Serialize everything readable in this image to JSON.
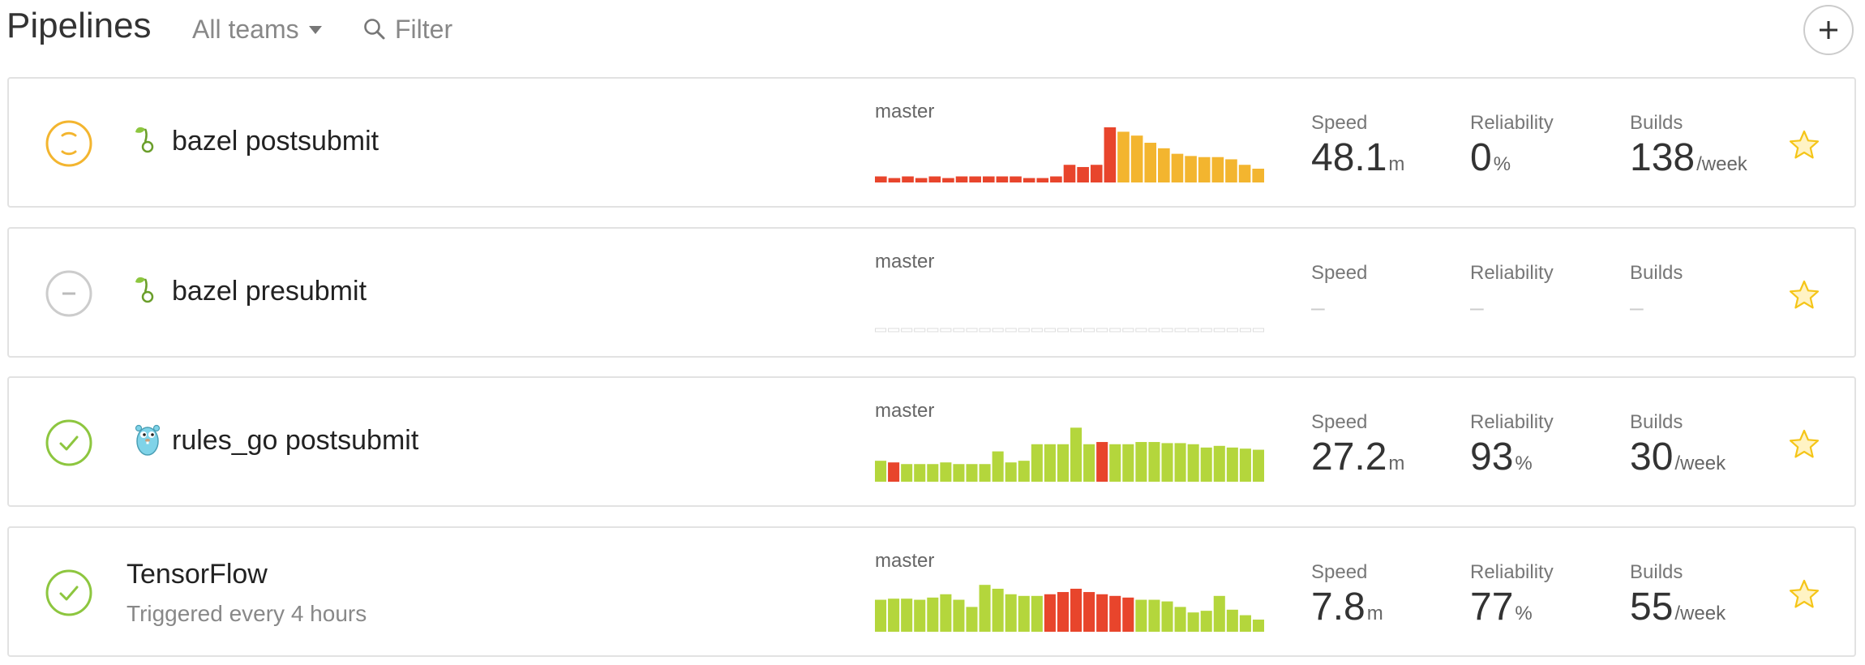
{
  "header": {
    "title": "Pipelines",
    "teams_label": "All teams",
    "filter_placeholder": "Filter"
  },
  "pipelines": [
    {
      "name": "bazel postsubmit",
      "subtitle": "",
      "status": "running",
      "icon": "bazel-sprout-icon",
      "branch": "master",
      "speed": {
        "label": "Speed",
        "value": "48.1",
        "unit": "m"
      },
      "reliability": {
        "label": "Reliability",
        "value": "0",
        "unit": "%"
      },
      "builds": {
        "label": "Builds",
        "value": "138",
        "unit": "/week"
      },
      "history": [
        {
          "v": 0.11,
          "s": "failed"
        },
        {
          "v": 0.08,
          "s": "failed"
        },
        {
          "v": 0.11,
          "s": "failed"
        },
        {
          "v": 0.08,
          "s": "failed"
        },
        {
          "v": 0.11,
          "s": "failed"
        },
        {
          "v": 0.08,
          "s": "failed"
        },
        {
          "v": 0.11,
          "s": "failed"
        },
        {
          "v": 0.11,
          "s": "failed"
        },
        {
          "v": 0.11,
          "s": "failed"
        },
        {
          "v": 0.11,
          "s": "failed"
        },
        {
          "v": 0.11,
          "s": "failed"
        },
        {
          "v": 0.08,
          "s": "failed"
        },
        {
          "v": 0.08,
          "s": "failed"
        },
        {
          "v": 0.11,
          "s": "failed"
        },
        {
          "v": 0.32,
          "s": "failed"
        },
        {
          "v": 0.28,
          "s": "failed"
        },
        {
          "v": 0.32,
          "s": "failed"
        },
        {
          "v": 1.0,
          "s": "failed"
        },
        {
          "v": 0.92,
          "s": "running"
        },
        {
          "v": 0.85,
          "s": "running"
        },
        {
          "v": 0.72,
          "s": "running"
        },
        {
          "v": 0.62,
          "s": "running"
        },
        {
          "v": 0.52,
          "s": "running"
        },
        {
          "v": 0.48,
          "s": "running"
        },
        {
          "v": 0.46,
          "s": "running"
        },
        {
          "v": 0.46,
          "s": "running"
        },
        {
          "v": 0.42,
          "s": "running"
        },
        {
          "v": 0.32,
          "s": "running"
        },
        {
          "v": 0.25,
          "s": "running"
        }
      ],
      "starred": true
    },
    {
      "name": "bazel presubmit",
      "subtitle": "",
      "status": "none",
      "icon": "bazel-sprout-icon",
      "branch": "master",
      "speed": {
        "label": "Speed",
        "value": "–",
        "unit": ""
      },
      "reliability": {
        "label": "Reliability",
        "value": "–",
        "unit": ""
      },
      "builds": {
        "label": "Builds",
        "value": "–",
        "unit": ""
      },
      "history": [
        {
          "v": 0,
          "s": "empty"
        },
        {
          "v": 0,
          "s": "empty"
        },
        {
          "v": 0,
          "s": "empty"
        },
        {
          "v": 0,
          "s": "empty"
        },
        {
          "v": 0,
          "s": "empty"
        },
        {
          "v": 0,
          "s": "empty"
        },
        {
          "v": 0,
          "s": "empty"
        },
        {
          "v": 0,
          "s": "empty"
        },
        {
          "v": 0,
          "s": "empty"
        },
        {
          "v": 0,
          "s": "empty"
        },
        {
          "v": 0,
          "s": "empty"
        },
        {
          "v": 0,
          "s": "empty"
        },
        {
          "v": 0,
          "s": "empty"
        },
        {
          "v": 0,
          "s": "empty"
        },
        {
          "v": 0,
          "s": "empty"
        },
        {
          "v": 0,
          "s": "empty"
        },
        {
          "v": 0,
          "s": "empty"
        },
        {
          "v": 0,
          "s": "empty"
        },
        {
          "v": 0,
          "s": "empty"
        },
        {
          "v": 0,
          "s": "empty"
        },
        {
          "v": 0,
          "s": "empty"
        },
        {
          "v": 0,
          "s": "empty"
        },
        {
          "v": 0,
          "s": "empty"
        },
        {
          "v": 0,
          "s": "empty"
        },
        {
          "v": 0,
          "s": "empty"
        },
        {
          "v": 0,
          "s": "empty"
        },
        {
          "v": 0,
          "s": "empty"
        },
        {
          "v": 0,
          "s": "empty"
        },
        {
          "v": 0,
          "s": "empty"
        },
        {
          "v": 0,
          "s": "empty"
        }
      ],
      "starred": true
    },
    {
      "name": "rules_go postsubmit",
      "subtitle": "",
      "status": "passed",
      "icon": "gopher-icon",
      "branch": "master",
      "speed": {
        "label": "Speed",
        "value": "27.2",
        "unit": "m"
      },
      "reliability": {
        "label": "Reliability",
        "value": "93",
        "unit": "%"
      },
      "builds": {
        "label": "Builds",
        "value": "30",
        "unit": "/week"
      },
      "history": [
        {
          "v": 0.38,
          "s": "passed"
        },
        {
          "v": 0.35,
          "s": "failed"
        },
        {
          "v": 0.32,
          "s": "passed"
        },
        {
          "v": 0.32,
          "s": "passed"
        },
        {
          "v": 0.32,
          "s": "passed"
        },
        {
          "v": 0.35,
          "s": "passed"
        },
        {
          "v": 0.32,
          "s": "passed"
        },
        {
          "v": 0.32,
          "s": "passed"
        },
        {
          "v": 0.32,
          "s": "passed"
        },
        {
          "v": 0.55,
          "s": "passed"
        },
        {
          "v": 0.35,
          "s": "passed"
        },
        {
          "v": 0.38,
          "s": "passed"
        },
        {
          "v": 0.68,
          "s": "passed"
        },
        {
          "v": 0.68,
          "s": "passed"
        },
        {
          "v": 0.68,
          "s": "passed"
        },
        {
          "v": 0.98,
          "s": "passed"
        },
        {
          "v": 0.68,
          "s": "passed"
        },
        {
          "v": 0.72,
          "s": "failed"
        },
        {
          "v": 0.68,
          "s": "passed"
        },
        {
          "v": 0.68,
          "s": "passed"
        },
        {
          "v": 0.72,
          "s": "passed"
        },
        {
          "v": 0.72,
          "s": "passed"
        },
        {
          "v": 0.7,
          "s": "passed"
        },
        {
          "v": 0.7,
          "s": "passed"
        },
        {
          "v": 0.68,
          "s": "passed"
        },
        {
          "v": 0.62,
          "s": "passed"
        },
        {
          "v": 0.65,
          "s": "passed"
        },
        {
          "v": 0.62,
          "s": "passed"
        },
        {
          "v": 0.6,
          "s": "passed"
        },
        {
          "v": 0.58,
          "s": "passed"
        }
      ],
      "starred": true
    },
    {
      "name": "TensorFlow",
      "subtitle": "Triggered every 4 hours",
      "status": "passed",
      "icon": "",
      "branch": "master",
      "speed": {
        "label": "Speed",
        "value": "7.8",
        "unit": "m"
      },
      "reliability": {
        "label": "Reliability",
        "value": "77",
        "unit": "%"
      },
      "builds": {
        "label": "Builds",
        "value": "55",
        "unit": "/week"
      },
      "history": [
        {
          "v": 0.58,
          "s": "passed"
        },
        {
          "v": 0.6,
          "s": "passed"
        },
        {
          "v": 0.6,
          "s": "passed"
        },
        {
          "v": 0.58,
          "s": "passed"
        },
        {
          "v": 0.62,
          "s": "passed"
        },
        {
          "v": 0.68,
          "s": "passed"
        },
        {
          "v": 0.58,
          "s": "passed"
        },
        {
          "v": 0.45,
          "s": "passed"
        },
        {
          "v": 0.85,
          "s": "passed"
        },
        {
          "v": 0.78,
          "s": "passed"
        },
        {
          "v": 0.68,
          "s": "passed"
        },
        {
          "v": 0.65,
          "s": "passed"
        },
        {
          "v": 0.65,
          "s": "passed"
        },
        {
          "v": 0.68,
          "s": "failed"
        },
        {
          "v": 0.72,
          "s": "failed"
        },
        {
          "v": 0.78,
          "s": "failed"
        },
        {
          "v": 0.72,
          "s": "failed"
        },
        {
          "v": 0.68,
          "s": "failed"
        },
        {
          "v": 0.65,
          "s": "failed"
        },
        {
          "v": 0.62,
          "s": "failed"
        },
        {
          "v": 0.58,
          "s": "passed"
        },
        {
          "v": 0.58,
          "s": "passed"
        },
        {
          "v": 0.55,
          "s": "passed"
        },
        {
          "v": 0.45,
          "s": "passed"
        },
        {
          "v": 0.35,
          "s": "passed"
        },
        {
          "v": 0.38,
          "s": "passed"
        },
        {
          "v": 0.65,
          "s": "passed"
        },
        {
          "v": 0.4,
          "s": "passed"
        },
        {
          "v": 0.3,
          "s": "passed"
        },
        {
          "v": 0.22,
          "s": "passed"
        }
      ],
      "starred": true
    }
  ],
  "colors": {
    "failed": "#e8452c",
    "running": "#f3b52f",
    "passed": "#b4d63c",
    "empty": "#dddddd",
    "status_passed": "#8dc63f",
    "status_running": "#f3b52f",
    "status_none": "#cccccc",
    "star": "#f5c518"
  }
}
